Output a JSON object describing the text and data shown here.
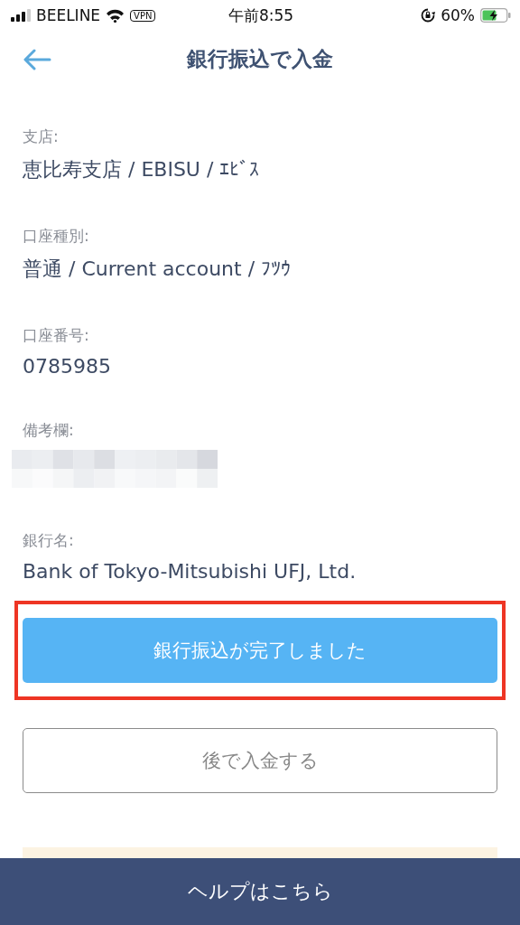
{
  "status_bar": {
    "carrier": "BEELINE",
    "vpn": "VPN",
    "time": "午前8:55",
    "battery": "60%"
  },
  "header": {
    "title": "銀行振込で入金"
  },
  "fields": [
    {
      "label": "支店:",
      "kind": "text",
      "value": "恵比寿支店 / EBISU / ｴﾋﾞｽ"
    },
    {
      "label": "口座種別:",
      "kind": "text",
      "value": "普通 / Current account / ﾌﾂｳ"
    },
    {
      "label": "口座番号:",
      "kind": "text",
      "value": "0785985"
    },
    {
      "label": "備考欄:",
      "kind": "redacted"
    },
    {
      "label": "銀行名:",
      "kind": "text",
      "value": "Bank of Tokyo-Mitsubishi UFJ, Ltd."
    }
  ],
  "buttons": [
    {
      "label": "銀行振込が完了しました",
      "kind": "primary",
      "highlighted": true
    },
    {
      "label": "後で入金する",
      "kind": "secondary",
      "highlighted": false
    }
  ],
  "footer": {
    "label": "ヘルプはこちら"
  }
}
